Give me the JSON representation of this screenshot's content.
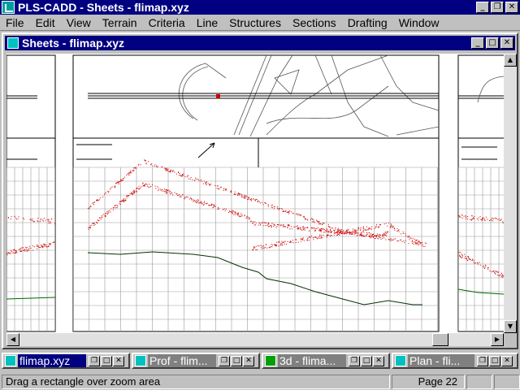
{
  "app": {
    "title": "PLS-CADD - Sheets - flimap.xyz"
  },
  "menu": [
    "File",
    "Edit",
    "View",
    "Terrain",
    "Criteria",
    "Line",
    "Structures",
    "Sections",
    "Drafting",
    "Window"
  ],
  "window": {
    "title": "Sheets - flimap.xyz"
  },
  "taskbar": [
    {
      "label": "flimap.xyz",
      "active": true
    },
    {
      "label": "Prof - flim...",
      "active": false
    },
    {
      "label": "3d - flima...",
      "active": false
    },
    {
      "label": "Plan - fli...",
      "active": false
    }
  ],
  "status": {
    "message": "Drag a rectangle over zoom area",
    "page": "Page 22"
  },
  "icons": {
    "minimize": "minimize-icon",
    "restore": "restore-icon",
    "maximize": "maximize-icon",
    "close": "close-icon"
  },
  "colors": {
    "titlebar": "#000080",
    "terrain_points": "#cc0000",
    "ground_line": "#006600"
  }
}
